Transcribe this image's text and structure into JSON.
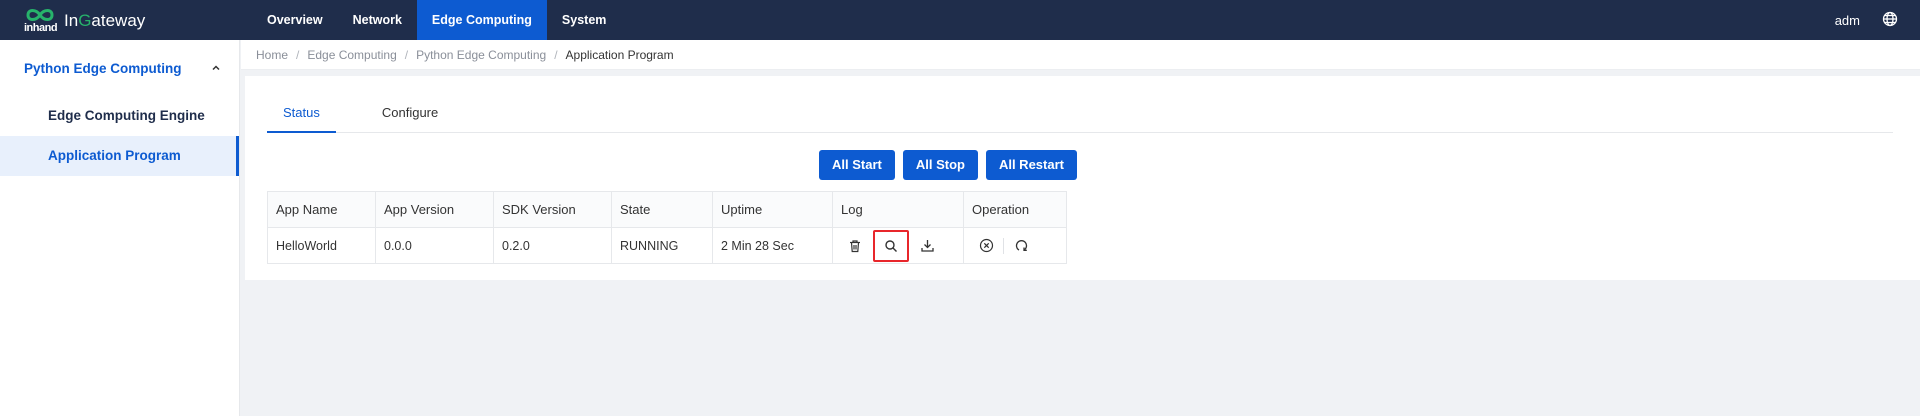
{
  "header": {
    "brand_small": "inhand",
    "title_prefix": "In",
    "title_g": "G",
    "title_suffix": "ateway",
    "nav": [
      "Overview",
      "Network",
      "Edge Computing",
      "System"
    ],
    "user": "adm"
  },
  "sidebar": {
    "group_label": "Python Edge Computing",
    "items": [
      "Edge Computing Engine",
      "Application Program"
    ]
  },
  "breadcrumb": [
    "Home",
    "Edge Computing",
    "Python Edge Computing",
    "Application Program"
  ],
  "tabs": [
    "Status",
    "Configure"
  ],
  "actions": {
    "all_start": "All Start",
    "all_stop": "All Stop",
    "all_restart": "All Restart"
  },
  "table": {
    "headers": [
      "App Name",
      "App Version",
      "SDK Version",
      "State",
      "Uptime",
      "Log",
      "Operation"
    ],
    "rows": [
      {
        "app_name": "HelloWorld",
        "app_version": "0.0.0",
        "sdk_version": "0.2.0",
        "state": "RUNNING",
        "uptime": "2 Min 28 Sec"
      }
    ]
  },
  "colors": {
    "topbar": "#1f2d4b",
    "accent": "#0d5bd1",
    "logo_green": "#27b36b",
    "highlight": "#e8262b"
  }
}
